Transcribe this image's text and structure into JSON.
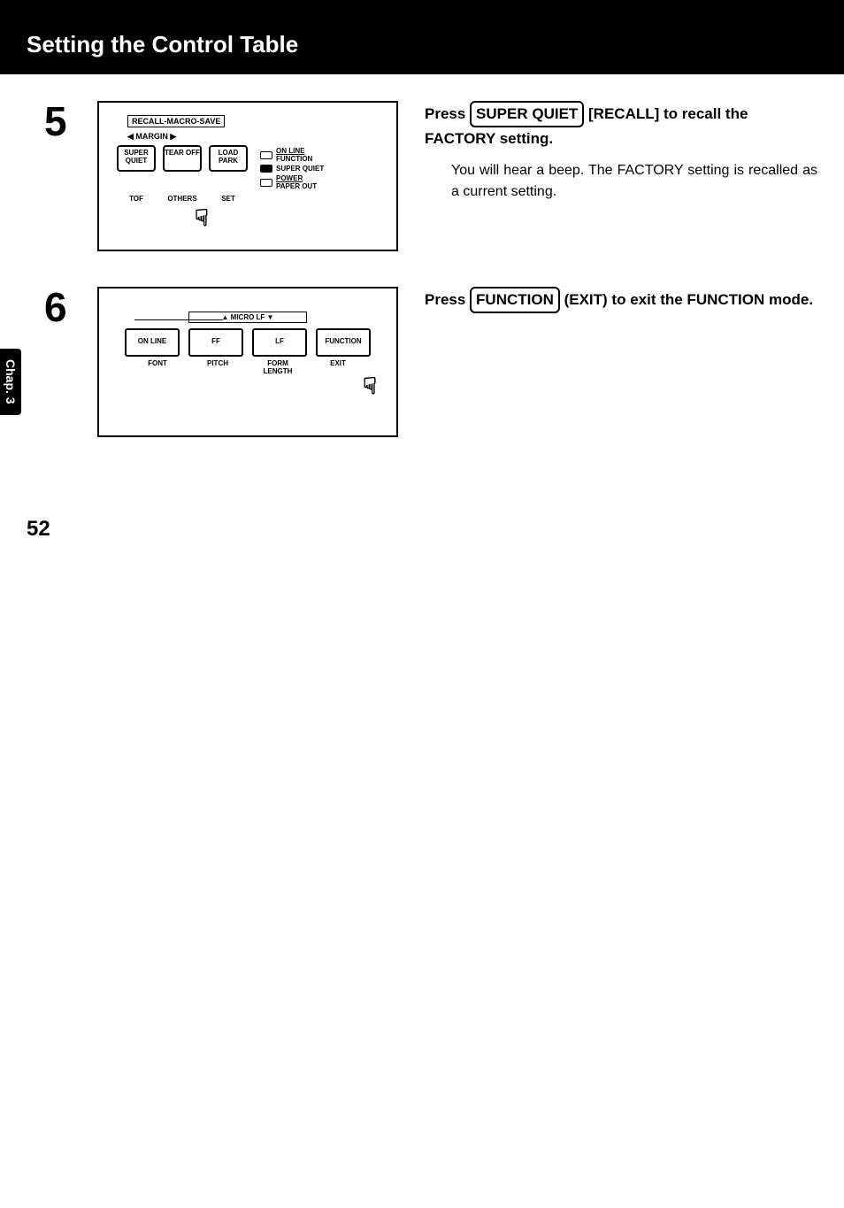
{
  "header": {
    "title": "Setting the Control Table"
  },
  "sidebar": {
    "chapter": "Chap. 3"
  },
  "steps": [
    {
      "number": "5",
      "instruction_prefix": "Press ",
      "keycap": "SUPER QUIET",
      "instruction_mid": " [RECALL] to recall the FACTORY setting.",
      "body": "You will hear a beep. The FACTORY setting is recalled as a current setting.",
      "panel": {
        "top_label": "RECALL-MACRO-SAVE",
        "margin_label": "◀ MARGIN ▶",
        "buttons": [
          "SUPER QUIET",
          "TEAR OFF",
          "LOAD PARK"
        ],
        "sub_labels": [
          "TOF",
          "OTHERS",
          "SET"
        ],
        "leds": [
          {
            "top": "ON LINE",
            "bottom": "FUNCTION"
          },
          {
            "label": "SUPER QUIET"
          },
          {
            "top": "POWER",
            "bottom": "PAPER OUT"
          }
        ]
      }
    },
    {
      "number": "6",
      "instruction_prefix": "Press ",
      "keycap": "FUNCTION",
      "instruction_mid": " (EXIT) to exit the FUNCTION mode.",
      "panel": {
        "top_label": "▲  MICRO LF  ▼",
        "buttons": [
          "ON LINE",
          "FF",
          "LF",
          "FUNCTION"
        ],
        "sub_labels": [
          "FONT",
          "PITCH",
          "FORM LENGTH",
          "EXIT"
        ]
      }
    }
  ],
  "page_number": "52"
}
